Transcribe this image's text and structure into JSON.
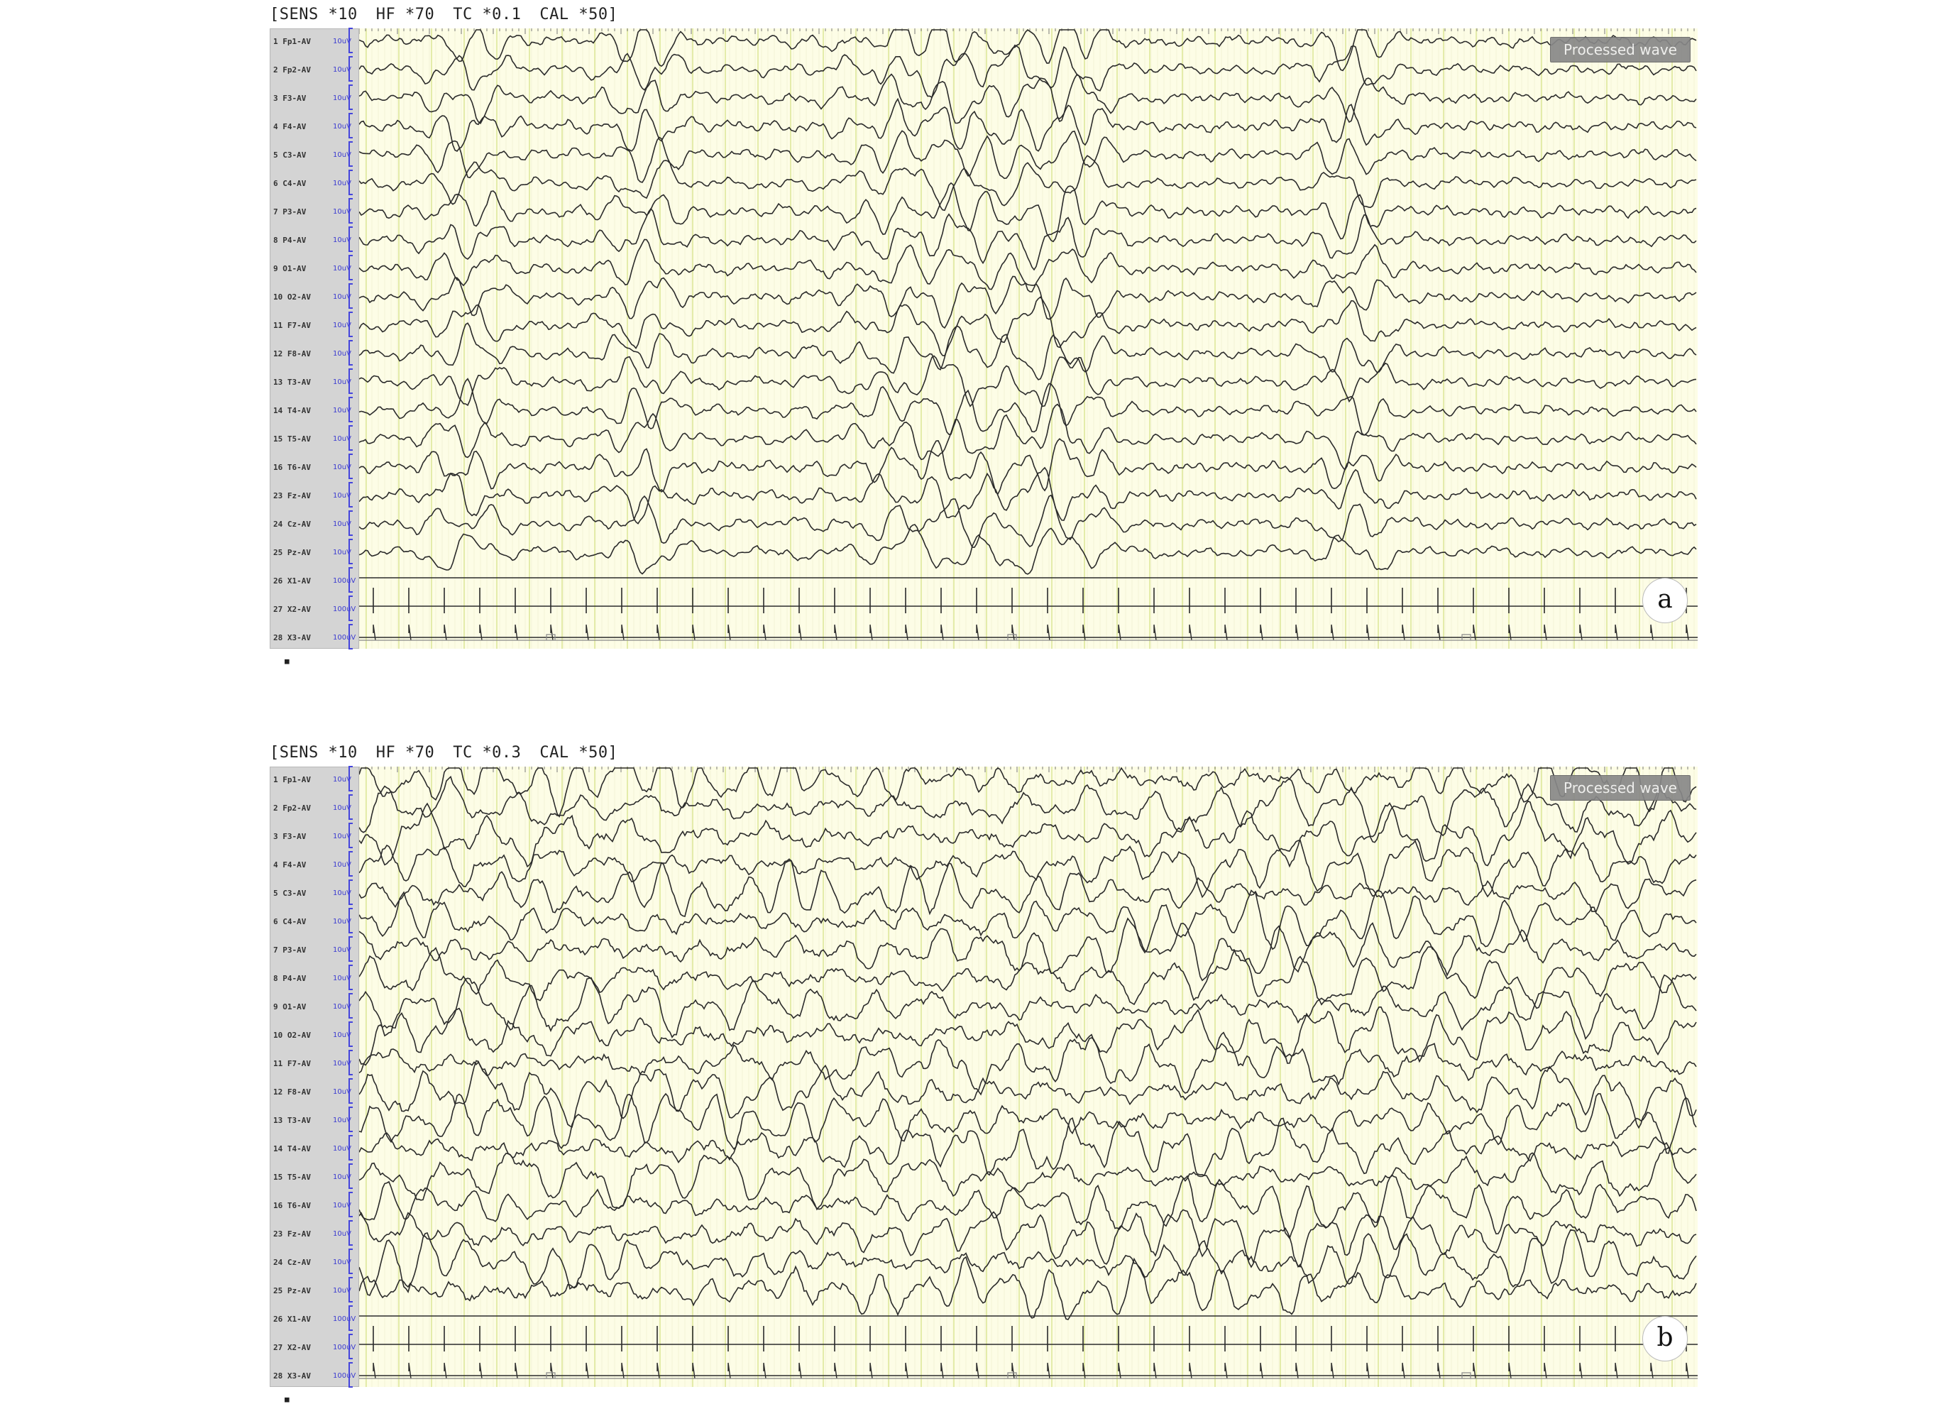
{
  "panels": [
    {
      "id": "a",
      "settings": {
        "sens": "[SENS *10",
        "hf": "HF *70",
        "tc": "TC *0.1",
        "cal": "CAL *50]"
      },
      "badge": "Processed wave",
      "letter": "a",
      "marker": "■"
    },
    {
      "id": "b",
      "settings": {
        "sens": "[SENS *10",
        "hf": "HF *70",
        "tc": "TC *0.3",
        "cal": "CAL *50]"
      },
      "badge": "Processed wave",
      "letter": "b",
      "marker": "■"
    }
  ],
  "channels": [
    {
      "num": "1",
      "name": "Fp1-AV",
      "sens": "10uV"
    },
    {
      "num": "2",
      "name": "Fp2-AV",
      "sens": "10uV"
    },
    {
      "num": "3",
      "name": "F3-AV",
      "sens": "10uV"
    },
    {
      "num": "4",
      "name": "F4-AV",
      "sens": "10uV"
    },
    {
      "num": "5",
      "name": "C3-AV",
      "sens": "10uV"
    },
    {
      "num": "6",
      "name": "C4-AV",
      "sens": "10uV"
    },
    {
      "num": "7",
      "name": "P3-AV",
      "sens": "10uV"
    },
    {
      "num": "8",
      "name": "P4-AV",
      "sens": "10uV"
    },
    {
      "num": "9",
      "name": "O1-AV",
      "sens": "10uV"
    },
    {
      "num": "10",
      "name": "O2-AV",
      "sens": "10uV"
    },
    {
      "num": "11",
      "name": "F7-AV",
      "sens": "10uV"
    },
    {
      "num": "12",
      "name": "F8-AV",
      "sens": "10uV"
    },
    {
      "num": "13",
      "name": "T3-AV",
      "sens": "10uV"
    },
    {
      "num": "14",
      "name": "T4-AV",
      "sens": "10uV"
    },
    {
      "num": "15",
      "name": "T5-AV",
      "sens": "10uV"
    },
    {
      "num": "16",
      "name": "T6-AV",
      "sens": "10uV"
    },
    {
      "num": "23",
      "name": "Fz-AV",
      "sens": "10uV"
    },
    {
      "num": "24",
      "name": "Cz-AV",
      "sens": "10uV"
    },
    {
      "num": "25",
      "name": "Pz-AV",
      "sens": "10uV"
    },
    {
      "num": "26",
      "name": "X1-AV",
      "sens": "100uV"
    },
    {
      "num": "27",
      "name": "X2-AV",
      "sens": "100uV"
    },
    {
      "num": "28",
      "name": "X3-AV",
      "sens": "100uV"
    }
  ],
  "colors": {
    "plot_background": "#fdfde6",
    "grid_major": "#e4ecaa",
    "grid_minor": "#f3f3d6",
    "trace": "#2b2b2b",
    "channel_panel": "#d4d4d4",
    "sens_text": "#3a3ad0"
  }
}
